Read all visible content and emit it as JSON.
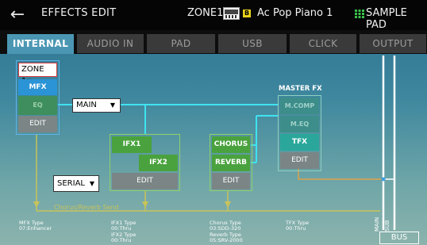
{
  "header": {
    "title": "EFFECTS EDIT",
    "zone": "ZONE1",
    "tone_badge": "B",
    "tone_name": "Ac Pop Piano 1",
    "pad_label": "SAMPLE PAD"
  },
  "tabs": [
    {
      "label": "INTERNAL",
      "active": true
    },
    {
      "label": "AUDIO IN",
      "active": false
    },
    {
      "label": "PAD",
      "active": false
    },
    {
      "label": "USB",
      "active": false
    },
    {
      "label": "CLICK",
      "active": false
    },
    {
      "label": "OUTPUT",
      "active": false
    }
  ],
  "zone_block": {
    "zone_select": "ZONE 1",
    "mfx": "MFX",
    "eq": "EQ",
    "edit": "EDIT"
  },
  "main_select": "MAIN",
  "serial_select": "SERIAL",
  "ifx_block": {
    "ifx1": "IFX1",
    "ifx2": "IFX2",
    "edit": "EDIT"
  },
  "send_block": {
    "chorus": "CHORUS",
    "reverb": "REVERB",
    "edit": "EDIT"
  },
  "master_fx": {
    "title": "MASTER FX",
    "m_comp": "M.COMP",
    "m_eq": "M.EQ",
    "tfx": "TFX",
    "edit": "EDIT"
  },
  "chorus_reverb_send": "Chorus/Reverb Send",
  "info": {
    "mfx_type_label": "MFX Type",
    "mfx_type_value": "07:Enhancer",
    "ifx1_type_label": "IFX1 Type",
    "ifx1_type_value": "00:Thru",
    "ifx2_type_label": "IFX2 Type",
    "ifx2_type_value": "00:Thru",
    "chorus_type_label": "Chorus Type",
    "chorus_type_value": "03:SDD-320",
    "reverb_type_label": "Reverb Type",
    "reverb_type_value": "05:SRV-2000",
    "tfx_type_label": "TFX Type",
    "tfx_type_value": "00:Thru"
  },
  "bus": {
    "main": "MAIN",
    "sub": "SUB",
    "button": "BUS"
  },
  "colors": {
    "top_bar": "#050505",
    "tab_active": "#4b97b3",
    "tab_inactive": "#3a3a3a",
    "mfx_blue": "#2a94d6",
    "eq_green": "#3e8f5d",
    "edit_gray": "#7b8585",
    "fx_green": "#4aa23e",
    "tfx_teal": "#2aa79a",
    "line_cyan": "#3fe3f0",
    "line_orange": "#e0a24a",
    "line_olive": "#c8c35a",
    "pad_icon_green": "#39c04a"
  },
  "icons": {
    "back": "back-arrow-icon",
    "keyboard": "keyboard-icon",
    "pad": "sample-pad-grid-icon"
  }
}
